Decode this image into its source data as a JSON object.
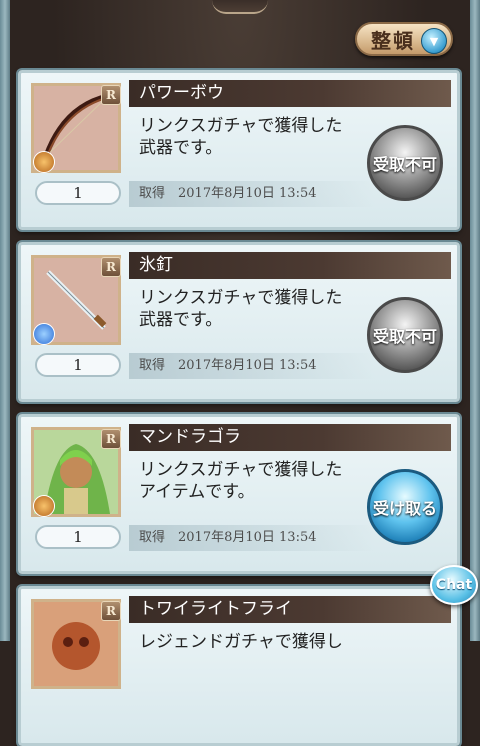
{
  "sort_button": {
    "label": "整頓",
    "icon": "chevron-down-icon"
  },
  "items": [
    {
      "name": "パワーボウ",
      "rarity": "R",
      "description_line1": "リンクスガチャで獲得した",
      "description_line2": "武器です。",
      "quantity": "1",
      "acquired": "取得　2017年8月10日 13:54",
      "button_label": "受取不可",
      "button_state": "disabled",
      "element_icon": "fire-element-icon",
      "element_color": "#c0762e",
      "thumbnail": "bow"
    },
    {
      "name": "氷釘",
      "rarity": "R",
      "description_line1": "リンクスガチャで獲得した",
      "description_line2": "武器です。",
      "quantity": "1",
      "acquired": "取得　2017年8月10日 13:54",
      "button_label": "受取不可",
      "button_state": "disabled",
      "element_icon": "water-element-icon",
      "element_color": "#2f6fd6",
      "thumbnail": "dagger"
    },
    {
      "name": "マンドラゴラ",
      "rarity": "R",
      "description_line1": "リンクスガチャで獲得した",
      "description_line2": "アイテムです。",
      "quantity": "1",
      "acquired": "取得　2017年8月10日 13:54",
      "button_label": "受け取る",
      "button_state": "active",
      "element_icon": "fire-element-icon",
      "element_color": "#c0762e",
      "thumbnail": "character"
    },
    {
      "name": "トワイライトフライ",
      "rarity": "R",
      "description_line1": "レジェンドガチャで獲得し",
      "description_line2": "",
      "quantity": "",
      "acquired": "",
      "button_label": "",
      "button_state": "disabled",
      "element_icon": "fire-element-icon",
      "element_color": "#c0762e",
      "thumbnail": "creature"
    }
  ],
  "chat_button": {
    "label": "Chat"
  }
}
